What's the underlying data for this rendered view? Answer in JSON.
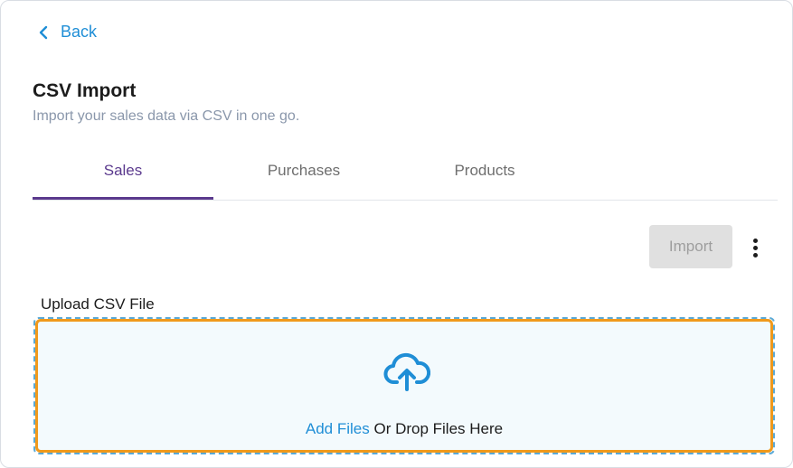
{
  "nav": {
    "back_label": "Back"
  },
  "header": {
    "title": "CSV Import",
    "subtitle": "Import your sales data via CSV in one go."
  },
  "tabs": [
    {
      "label": "Sales",
      "active": true
    },
    {
      "label": "Purchases",
      "active": false
    },
    {
      "label": "Products",
      "active": false
    }
  ],
  "toolbar": {
    "import_label": "Import",
    "more_icon": "more-vertical-icon"
  },
  "upload": {
    "label": "Upload CSV File",
    "icon": "cloud-upload-icon",
    "add_files_label": "Add Files",
    "drop_text": " Or Drop Files Here"
  },
  "colors": {
    "accent_link": "#1f8ed6",
    "active_tab": "#5b3a8e",
    "highlight": "#f0991b",
    "dropzone_bg": "#f3fafd"
  }
}
